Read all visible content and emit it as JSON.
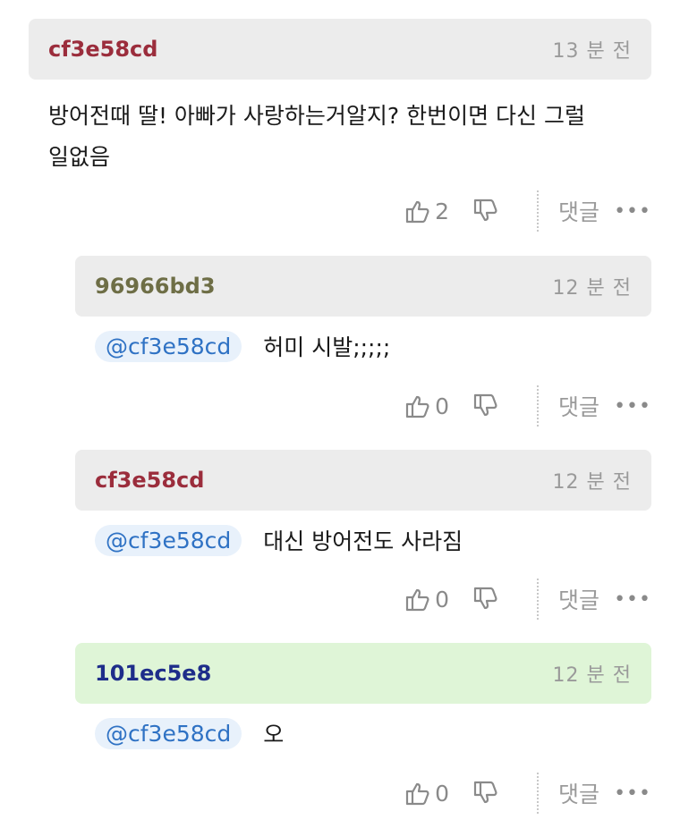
{
  "comments": [
    {
      "author": "cf3e58cd",
      "author_color": "#9b2d3c",
      "time": "13 분 전",
      "text_line1": "방어전때 딸! 아빠가 사랑하는거알지? 한번이면 다신 그럴",
      "text_line2": "일없음",
      "likes": "2",
      "reply_label": "댓글",
      "more_label": "•••"
    },
    {
      "author": "96966bd3",
      "author_color": "#6e6e46",
      "time": "12 분 전",
      "mention": "@cf3e58cd",
      "text": "허미 시발;;;;;",
      "likes": "0",
      "reply_label": "댓글",
      "more_label": "•••"
    },
    {
      "author": "cf3e58cd",
      "author_color": "#9b2d3c",
      "time": "12 분 전",
      "mention": "@cf3e58cd",
      "text": "대신 방어전도 사라짐",
      "likes": "0",
      "reply_label": "댓글",
      "more_label": "•••"
    },
    {
      "author": "101ec5e8",
      "author_color": "#1e2d8a",
      "time": "12 분 전",
      "mention": "@cf3e58cd",
      "text": "오",
      "likes": "0",
      "reply_label": "댓글",
      "more_label": "•••"
    }
  ]
}
